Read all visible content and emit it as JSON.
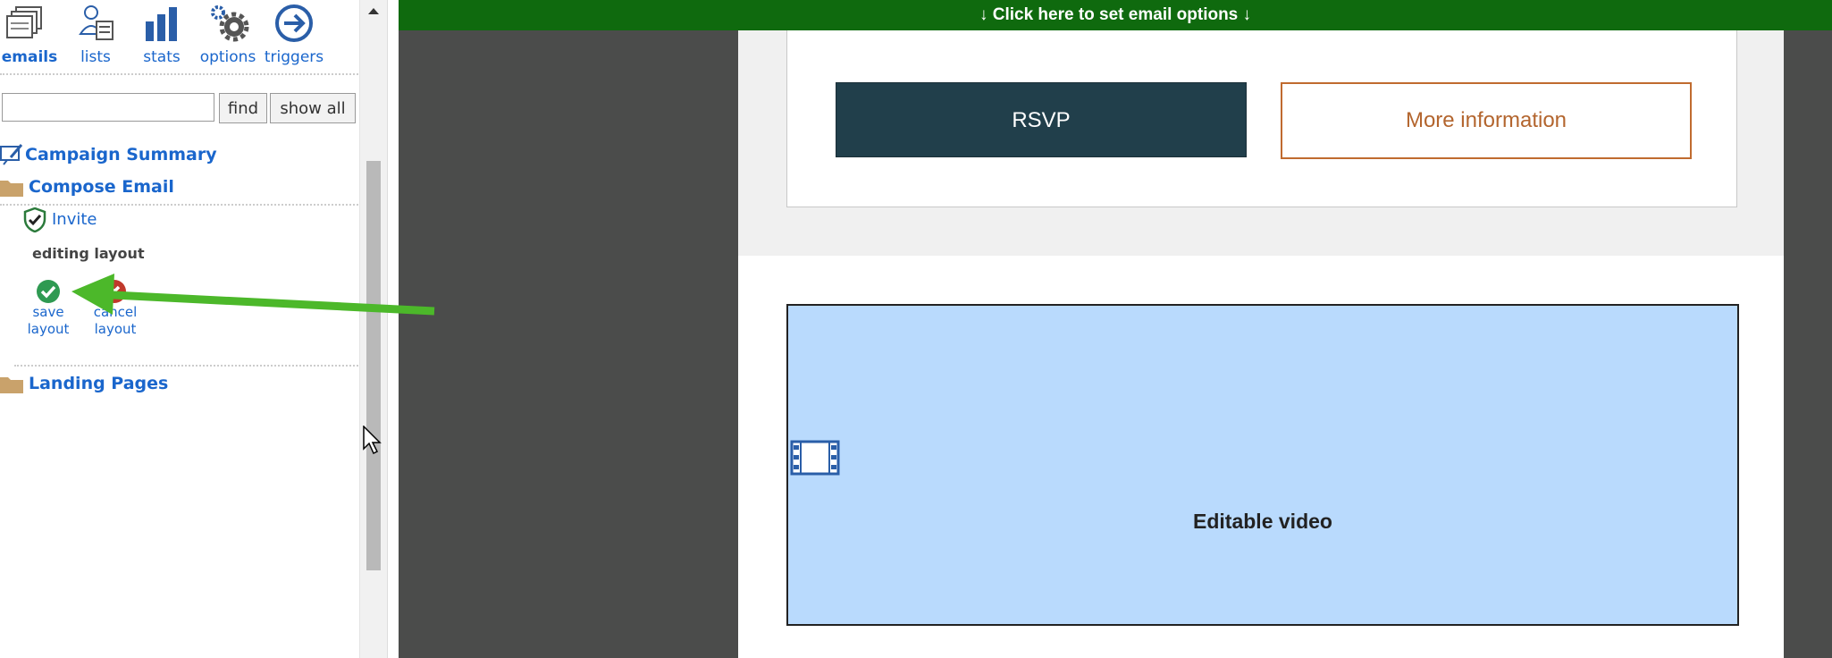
{
  "toolbar": {
    "items": [
      {
        "label": "emails",
        "icon": "emails-icon",
        "active": true
      },
      {
        "label": "lists",
        "icon": "lists-icon",
        "active": false
      },
      {
        "label": "stats",
        "icon": "stats-icon",
        "active": false
      },
      {
        "label": "options",
        "icon": "options-icon",
        "active": false
      },
      {
        "label": "triggers",
        "icon": "triggers-icon",
        "active": false
      }
    ]
  },
  "search": {
    "value": "",
    "find_label": "find",
    "show_all_label": "show all"
  },
  "tree": {
    "campaign_summary": "Campaign Summary",
    "compose_email": "Compose Email",
    "invite": "Invite",
    "editing_layout": "editing layout",
    "save_layout_line1": "save",
    "save_layout_line2": "layout",
    "cancel_layout_line1": "cancel",
    "cancel_layout_line2": "layout",
    "landing_pages": "Landing Pages"
  },
  "banner": {
    "text": "↓   Click here to set email options   ↓"
  },
  "email": {
    "rsvp_label": "RSVP",
    "more_info_label": "More information",
    "video_label": "Editable video"
  },
  "colors": {
    "banner": "#0f6a0e",
    "rsvp_bg": "#213f4b",
    "more_info_border": "#c06b2f",
    "video_bg": "#b9dafd",
    "link": "#1a66cc",
    "annotation_arrow": "#4cb82a"
  }
}
